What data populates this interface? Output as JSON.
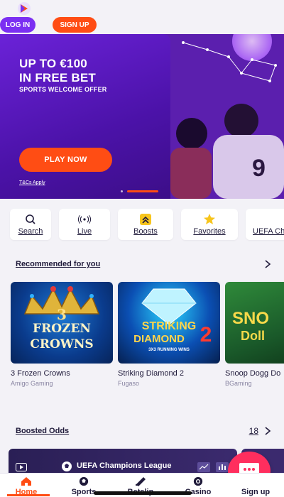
{
  "header": {
    "login_label": "LOG IN",
    "signup_label": "SIGN UP",
    "brand_color": "#7b2ff2",
    "accent_color": "#ff4d14"
  },
  "hero": {
    "title_line1": "UP TO €100",
    "title_line2": "IN FREE BET",
    "subtitle": "SPORTS WELCOME OFFER",
    "cta_label": "PLAY NOW",
    "terms_label": "T&Cs Apply",
    "jersey_number": "9"
  },
  "quick_nav": [
    {
      "label": "Search",
      "icon": "search-icon"
    },
    {
      "label": "Live",
      "icon": "live-signal-icon"
    },
    {
      "label": "Boosts",
      "icon": "boost-icon"
    },
    {
      "label": "Favorites",
      "icon": "star-icon"
    },
    {
      "label": "UEFA Ch",
      "icon": "trophy-icon"
    }
  ],
  "recommended": {
    "title": "Recommended for you",
    "games": [
      {
        "name": "3 Frozen Crowns",
        "provider": "Amigo Gaming",
        "thumb_text_1": "3",
        "thumb_text_2": "FROZEN",
        "thumb_text_3": "CROWNS"
      },
      {
        "name": "Striking Diamond 2",
        "provider": "Fugaso",
        "thumb_text_1": "STRIKING",
        "thumb_text_2": "DIAMOND",
        "thumb_text_3": "2",
        "thumb_text_4": "3X3 RUNNING WINS"
      },
      {
        "name": "Snoop Dogg Do",
        "provider": "BGaming",
        "thumb_text_1": "SNO",
        "thumb_text_2": "Doll"
      }
    ]
  },
  "boosted": {
    "title": "Boosted Odds",
    "count": "18",
    "league": "UEFA Champions League"
  },
  "bottom_nav": [
    {
      "label": "Home",
      "icon": "home-icon",
      "active": true
    },
    {
      "label": "Sports",
      "icon": "soccer-ball-icon",
      "active": false
    },
    {
      "label": "Betslip",
      "icon": "betslip-icon",
      "active": false
    },
    {
      "label": "Casino",
      "icon": "casino-chip-icon",
      "active": false
    },
    {
      "label": "Sign up",
      "icon": "signup-icon",
      "active": false
    }
  ]
}
